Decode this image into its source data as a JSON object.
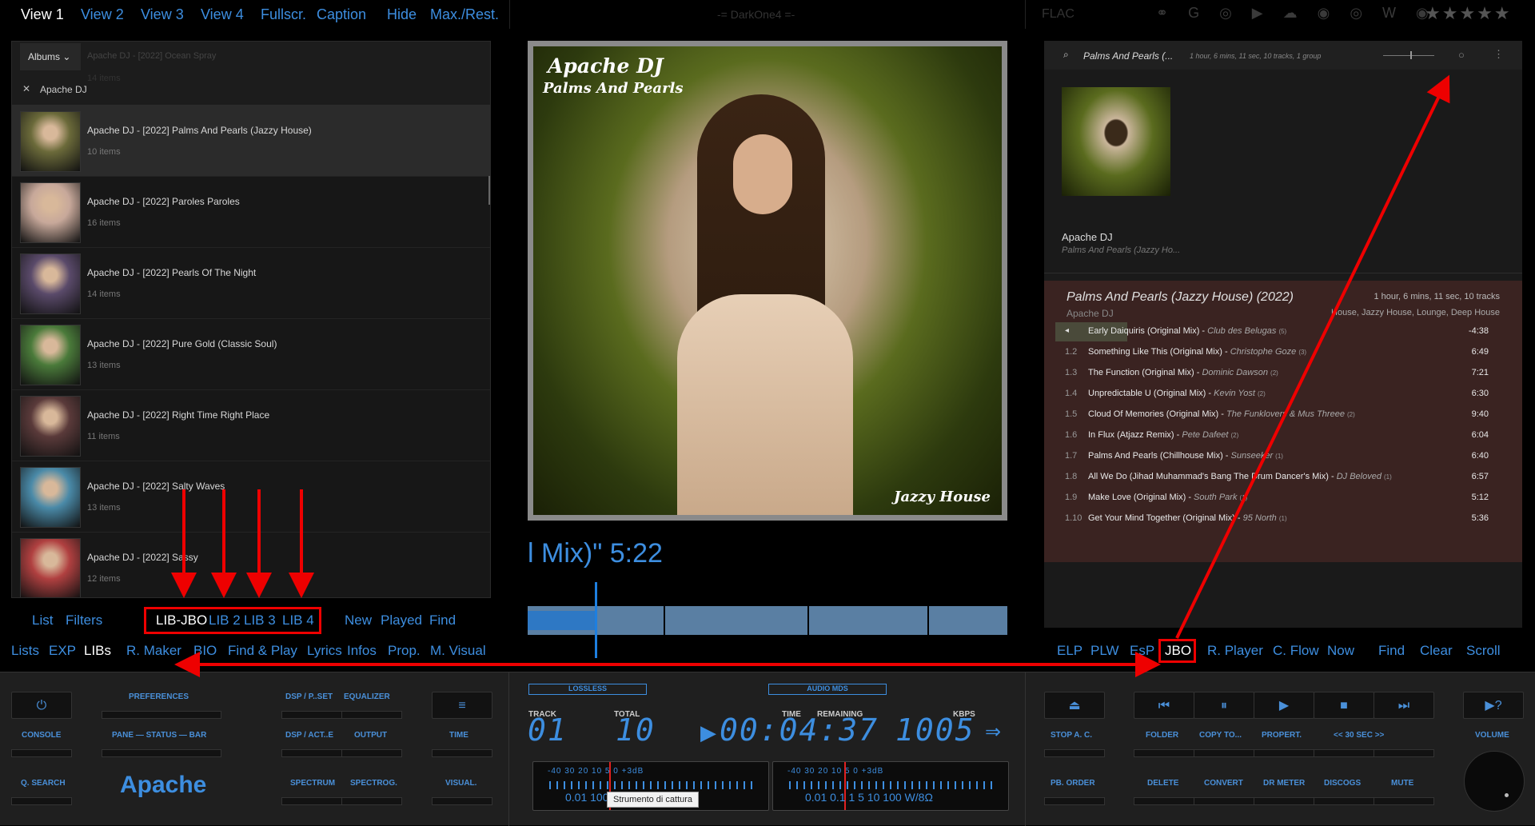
{
  "top": {
    "views": [
      "View 1",
      "View 2",
      "View 3",
      "View 4",
      "Fullscr.",
      "Caption",
      "Hide",
      "Max./Rest."
    ],
    "center_title": "-= DarkOne4 =-",
    "format": "FLAC"
  },
  "albums": {
    "dropdown": "Albums",
    "filter_chip": "Apache DJ",
    "ghost_row": "Apache DJ - [2022] Ocean Spray",
    "ghost_count": "14 items",
    "rows": [
      {
        "title": "Apache DJ - [2022] Palms And Pearls (Jazzy House)",
        "count": "10 items"
      },
      {
        "title": "Apache DJ - [2022] Paroles Paroles",
        "count": "16 items"
      },
      {
        "title": "Apache DJ - [2022] Pearls Of The Night",
        "count": "14 items"
      },
      {
        "title": "Apache DJ - [2022] Pure Gold (Classic Soul)",
        "count": "13 items"
      },
      {
        "title": "Apache DJ - [2022] Right Time Right Place",
        "count": "11 items"
      },
      {
        "title": "Apache DJ - [2022] Salty Waves",
        "count": "13 items"
      },
      {
        "title": "Apache DJ - [2022] Sassy",
        "count": "12 items"
      }
    ]
  },
  "left_bottom": {
    "row1": [
      "List",
      "Filters",
      "LIB-JBO",
      "LIB 2",
      "LIB 3",
      "LIB 4",
      "New",
      "Played",
      "Find"
    ],
    "row2": [
      "Lists",
      "EXP",
      "LIBs",
      "R. Maker",
      "BIO",
      "Find & Play",
      "Lyrics",
      "Infos",
      "Prop.",
      "M. Visual"
    ]
  },
  "cover": {
    "line1": "Apache DJ",
    "line2": "Palms And Pearls",
    "genre": "Jazzy House"
  },
  "now_playing_text": "l Mix)\" 5:22",
  "right_bottom": [
    "ELP",
    "PLW",
    "EsP",
    "JBO",
    "R. Player",
    "C. Flow",
    "Now",
    "Find",
    "Clear",
    "Scroll"
  ],
  "panel": {
    "search": "Palms And Pearls (...",
    "summary": "1 hour, 6 mins, 11 sec,  10 tracks,  1 group",
    "artist": "Apache DJ",
    "album_sub": "Palms And Pearls (Jazzy Ho...",
    "album_title": "Palms And Pearls (Jazzy House) (2022)",
    "album_artist": "Apache DJ",
    "album_length": "1 hour, 6 mins, 11 sec,  10 tracks",
    "album_genres": "House, Jazzy House, Lounge, Deep House",
    "tracks": [
      {
        "n": "",
        "title": "Early Daiquiris (Original Mix)",
        "artist": "Club des Belugas",
        "count": "(5)",
        "dur": "-4:38"
      },
      {
        "n": "1.2",
        "title": "Something Like This (Original Mix)",
        "artist": "Christophe Goze",
        "count": "(3)",
        "dur": "6:49"
      },
      {
        "n": "1.3",
        "title": "The Function (Original Mix)",
        "artist": "Dominic Dawson",
        "count": "(2)",
        "dur": "7:21"
      },
      {
        "n": "1.4",
        "title": "Unpredictable U (Original Mix)",
        "artist": "Kevin Yost",
        "count": "(2)",
        "dur": "6:30"
      },
      {
        "n": "1.5",
        "title": "Cloud Of Memories (Original Mix)",
        "artist": "The Funklovers & Mus Threee",
        "count": "(2)",
        "dur": "9:40"
      },
      {
        "n": "1.6",
        "title": "In Flux (Atjazz Remix)",
        "artist": "Pete Dafeet",
        "count": "(2)",
        "dur": "6:04"
      },
      {
        "n": "1.7",
        "title": "Palms And Pearls (Chillhouse Mix)",
        "artist": "Sunseeker",
        "count": "(1)",
        "dur": "6:40"
      },
      {
        "n": "1.8",
        "title": "All We Do (Jihad Muhammad's Bang The Drum Dancer's Mix)",
        "artist": "DJ Beloved",
        "count": "(1)",
        "dur": "6:57"
      },
      {
        "n": "1.9",
        "title": "Make Love (Original Mix)",
        "artist": "South Park",
        "count": "(1)",
        "dur": "5:12"
      },
      {
        "n": "1.10",
        "title": "Get Your Mind Together (Original Mix)",
        "artist": "95 North",
        "count": "(1)",
        "dur": "5:36"
      }
    ]
  },
  "controls": {
    "left_labels": [
      "CONSOLE",
      "PREFERENCES",
      "PANE — STATUS — BAR",
      "DSP / P..SET",
      "EQUALIZER",
      "DSP / ACT..E",
      "OUTPUT",
      "TIME",
      "Q. SEARCH",
      "SPECTRUM",
      "SPECTROG.",
      "VISUAL."
    ],
    "brand": "Apache",
    "badges": [
      "LOSSLESS",
      "AUDIO MDS"
    ],
    "readouts": {
      "track_label": "TRACK",
      "track": "01",
      "total_label": "TOTAL",
      "total": "10",
      "time_label": "TIME",
      "time": "00:04:37",
      "remaining_label": "REMAINING",
      "kbps_label": "KBPS",
      "kbps": "1005"
    },
    "meter_scale": "-40    30    20    10  5    0 +3dB",
    "meter_scale2_left": "0.01          100 W/8Ω",
    "meter_scale2_right": "0.01    0.1    1   5 10   100 W/8Ω",
    "tooltip": "Strumento di cattura",
    "right_labels": [
      "STOP A. C.",
      "FOLDER",
      "COPY TO...",
      "PROPERT.",
      "<<   30 SEC   >>",
      "VOLUME",
      "PB. ORDER",
      "DELETE",
      "CONVERT",
      "DR METER",
      "DISCOGS",
      "MUTE"
    ]
  }
}
